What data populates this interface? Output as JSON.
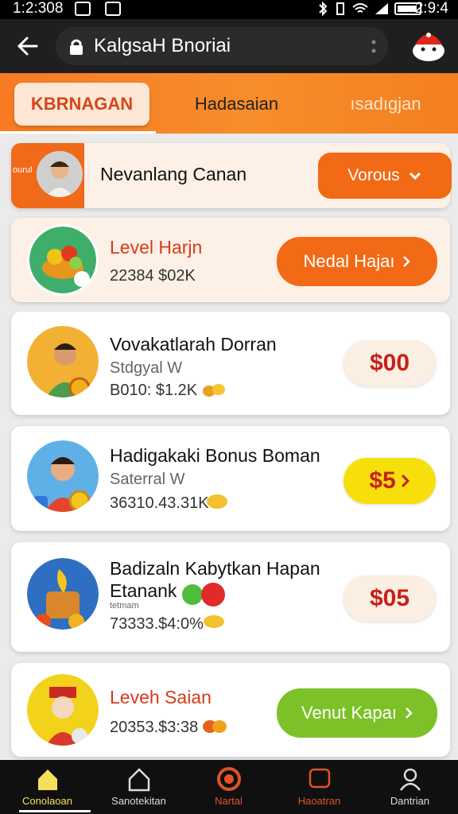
{
  "status_bar": {
    "time_left": "1:2:308",
    "time_right": "2:9:4"
  },
  "app_bar": {
    "title": "KalgsaH Bnoriai"
  },
  "tabs": [
    {
      "label": "KBRNAGAN"
    },
    {
      "label": "Hadasaian"
    },
    {
      "label": "ısadıgjan"
    }
  ],
  "profile": {
    "strip_text": "ourul",
    "name": "Nevanlang Canan",
    "button_label": "Vorous"
  },
  "level_card": {
    "title": "Level Harjn",
    "subtitle": "22384 $02K",
    "button_label": "Nedal Hajaı"
  },
  "offers": [
    {
      "title": "Vovakatlarah Dorran",
      "subtitle": "Stdgyal W",
      "meta": "B010: $1.2K",
      "price": "$00"
    },
    {
      "title": "Hadigakaki Bonus Boman",
      "subtitle": "Saterral W",
      "meta": "36310.43.31K",
      "price": "$5"
    },
    {
      "title": "Badizaln Kabytkan Hapan",
      "title2": "Etanank",
      "subtitle": "tetmam",
      "meta": "73333.$4:0%",
      "price": "$05"
    }
  ],
  "bottom_card": {
    "title": "Leveh Saian",
    "meta": "20353.$3:38",
    "button_label": "Venut Kapaı"
  },
  "bottom_nav": [
    {
      "label": "Conolaoan"
    },
    {
      "label": "Sanotekitan"
    },
    {
      "label": "Nartal"
    },
    {
      "label": "Haoatran"
    },
    {
      "label": "Dantrian"
    }
  ],
  "colors": {
    "accent_orange": "#f26a16",
    "price_red": "#c8201a",
    "yellow_button": "#f7df0c",
    "green_button": "#7cc128"
  }
}
